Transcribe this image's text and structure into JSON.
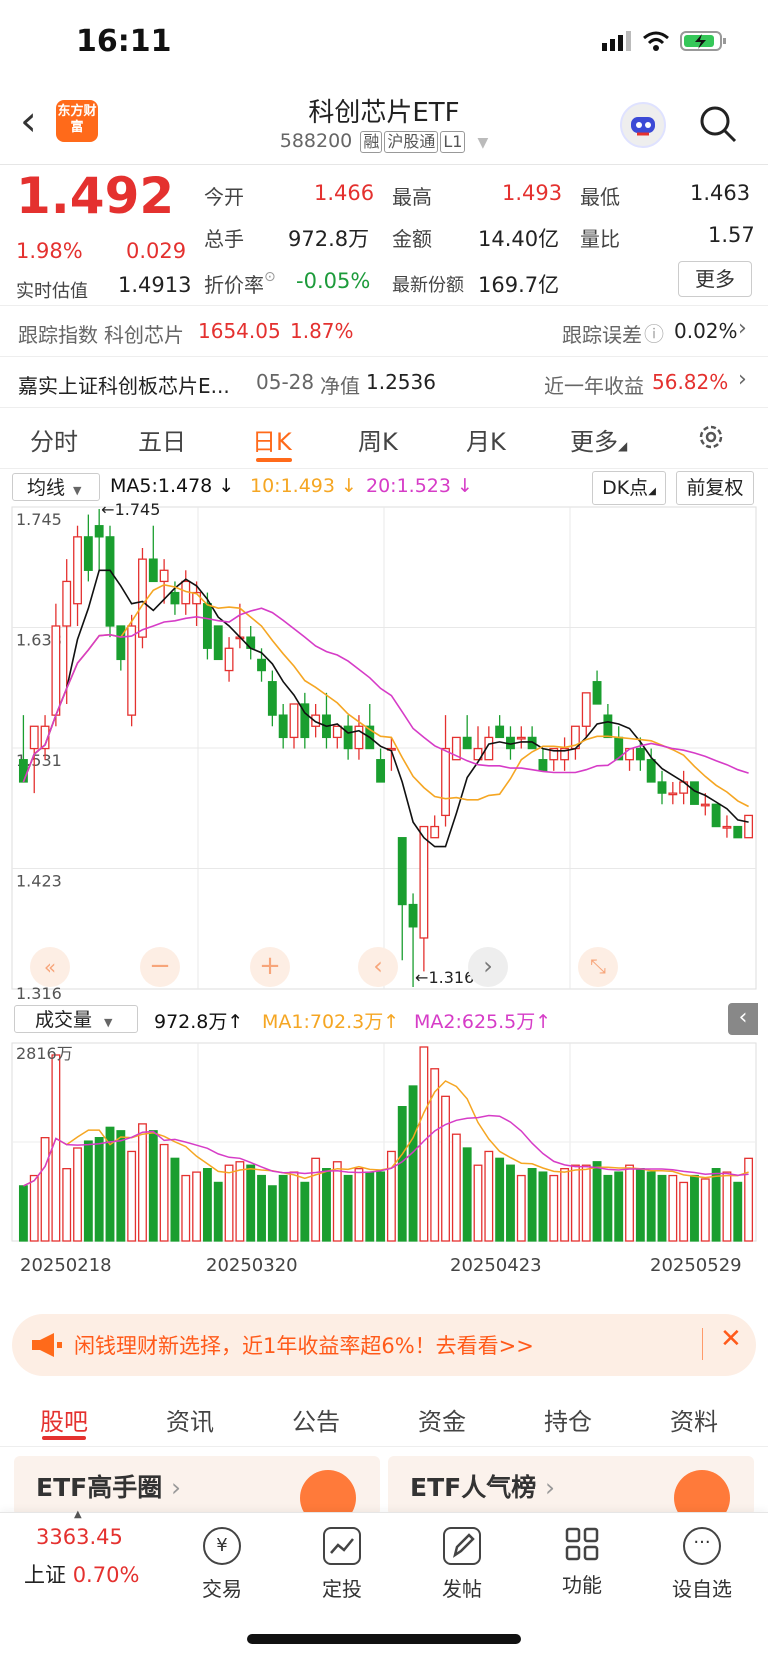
{
  "status": {
    "time": "16:11"
  },
  "header": {
    "back_icon": "chevron-left-icon",
    "logo_text": "东方财富",
    "title": "科创芯片ETF",
    "code": "588200",
    "tags": [
      "融",
      "沪股通",
      "L1"
    ]
  },
  "quote": {
    "price": "1.492",
    "change_pct": "1.98%",
    "change": "0.029",
    "est_label": "实时估值",
    "est_value": "1.4913",
    "open_label": "今开",
    "open": "1.466",
    "high_label": "最高",
    "high": "1.493",
    "low_label": "最低",
    "low": "1.463",
    "vol_label": "总手",
    "vol": "972.8万",
    "amt_label": "金额",
    "amt": "14.40亿",
    "ratio_label": "量比",
    "ratio": "1.57",
    "premium_label": "折价率",
    "premium": "-0.05%",
    "share_label": "最新份额",
    "share": "169.7亿",
    "more": "更多"
  },
  "tracking": {
    "label": "跟踪指数",
    "index": "科创芯片",
    "value": "1654.05",
    "pct": "1.87%",
    "err_label": "跟踪误差",
    "err": "0.02%"
  },
  "fund": {
    "name": "嘉实上证科创板芯片E...",
    "date": "05-28",
    "nav_label": "净值",
    "nav": "1.2536",
    "ret_label": "近一年收益",
    "ret": "56.82%"
  },
  "tabs": [
    "分时",
    "五日",
    "日K",
    "周K",
    "月K",
    "更多"
  ],
  "indicators": {
    "ma_select": "均线",
    "ma5": "MA5:1.478",
    "ma10": "10:1.493",
    "ma20": "20:1.523",
    "dk": "DK点",
    "adjust": "前复权"
  },
  "chart_labels": {
    "y_ticks": [
      "1.745",
      "1.638",
      "1.531",
      "1.423",
      "1.316"
    ],
    "high_mark": "1.745",
    "low_mark": "1.316",
    "vol_select": "成交量",
    "vol_value": "972.8万",
    "ma1": "MA1:702.3万",
    "ma2": "MA2:625.5万",
    "vol_max": "2816万",
    "dates": [
      "20250218",
      "20250320",
      "20250423",
      "20250529"
    ]
  },
  "colors": {
    "up": "#e4312f",
    "down": "#1a9e2f",
    "ma5": "#111111",
    "ma10": "#f5a623",
    "ma20": "#d63cc7",
    "accent": "#ff6a1a"
  },
  "chart_data": {
    "type": "candlestick",
    "ylim": [
      1.316,
      1.745
    ],
    "series": [
      {
        "name": "MA5",
        "value": 1.478
      },
      {
        "name": "10",
        "value": 1.493
      },
      {
        "name": "20",
        "value": 1.523
      }
    ],
    "candles": [
      [
        1.52,
        1.56,
        1.5,
        1.5
      ],
      [
        1.53,
        1.53,
        1.49,
        1.55
      ],
      [
        1.53,
        1.56,
        1.52,
        1.55
      ],
      [
        1.56,
        1.66,
        1.55,
        1.64
      ],
      [
        1.64,
        1.7,
        1.57,
        1.68
      ],
      [
        1.66,
        1.73,
        1.64,
        1.72
      ],
      [
        1.72,
        1.74,
        1.68,
        1.69
      ],
      [
        1.73,
        1.745,
        1.69,
        1.72
      ],
      [
        1.72,
        1.73,
        1.63,
        1.64
      ],
      [
        1.64,
        1.64,
        1.6,
        1.61
      ],
      [
        1.56,
        1.65,
        1.55,
        1.64
      ],
      [
        1.63,
        1.71,
        1.62,
        1.7
      ],
      [
        1.7,
        1.73,
        1.68,
        1.68
      ],
      [
        1.68,
        1.7,
        1.66,
        1.69
      ],
      [
        1.67,
        1.68,
        1.65,
        1.66
      ],
      [
        1.66,
        1.69,
        1.65,
        1.68
      ],
      [
        1.66,
        1.68,
        1.64,
        1.67
      ],
      [
        1.66,
        1.67,
        1.61,
        1.62
      ],
      [
        1.64,
        1.64,
        1.61,
        1.61
      ],
      [
        1.6,
        1.63,
        1.59,
        1.62
      ],
      [
        1.63,
        1.66,
        1.62,
        1.63
      ],
      [
        1.63,
        1.64,
        1.61,
        1.62
      ],
      [
        1.61,
        1.62,
        1.59,
        1.6
      ],
      [
        1.59,
        1.6,
        1.55,
        1.56
      ],
      [
        1.56,
        1.57,
        1.53,
        1.54
      ],
      [
        1.54,
        1.57,
        1.53,
        1.57
      ],
      [
        1.57,
        1.58,
        1.53,
        1.54
      ],
      [
        1.55,
        1.57,
        1.54,
        1.56
      ],
      [
        1.56,
        1.58,
        1.53,
        1.54
      ],
      [
        1.54,
        1.55,
        1.53,
        1.55
      ],
      [
        1.55,
        1.56,
        1.52,
        1.53
      ],
      [
        1.53,
        1.56,
        1.52,
        1.55
      ],
      [
        1.55,
        1.57,
        1.53,
        1.53
      ],
      [
        1.52,
        1.53,
        1.5,
        1.5
      ],
      [
        1.53,
        1.54,
        1.51,
        1.53
      ],
      [
        1.45,
        1.45,
        1.34,
        1.39
      ],
      [
        1.39,
        1.4,
        1.316,
        1.37
      ],
      [
        1.36,
        1.41,
        1.33,
        1.46
      ],
      [
        1.45,
        1.47,
        1.45,
        1.46
      ],
      [
        1.47,
        1.56,
        1.46,
        1.53
      ],
      [
        1.52,
        1.54,
        1.52,
        1.54
      ],
      [
        1.54,
        1.56,
        1.53,
        1.53
      ],
      [
        1.52,
        1.55,
        1.52,
        1.53
      ],
      [
        1.52,
        1.55,
        1.52,
        1.54
      ],
      [
        1.55,
        1.56,
        1.54,
        1.54
      ],
      [
        1.54,
        1.55,
        1.52,
        1.53
      ],
      [
        1.54,
        1.55,
        1.53,
        1.54
      ],
      [
        1.54,
        1.55,
        1.53,
        1.53
      ],
      [
        1.52,
        1.53,
        1.51,
        1.51
      ],
      [
        1.52,
        1.53,
        1.51,
        1.53
      ],
      [
        1.52,
        1.54,
        1.51,
        1.53
      ],
      [
        1.53,
        1.55,
        1.52,
        1.55
      ],
      [
        1.55,
        1.58,
        1.54,
        1.58
      ],
      [
        1.59,
        1.6,
        1.57,
        1.57
      ],
      [
        1.56,
        1.57,
        1.54,
        1.54
      ],
      [
        1.54,
        1.55,
        1.52,
        1.52
      ],
      [
        1.52,
        1.53,
        1.51,
        1.53
      ],
      [
        1.53,
        1.54,
        1.51,
        1.52
      ],
      [
        1.52,
        1.53,
        1.5,
        1.5
      ],
      [
        1.5,
        1.51,
        1.48,
        1.49
      ],
      [
        1.49,
        1.5,
        1.48,
        1.49
      ],
      [
        1.49,
        1.51,
        1.48,
        1.5
      ],
      [
        1.5,
        1.5,
        1.48,
        1.48
      ],
      [
        1.48,
        1.49,
        1.47,
        1.48
      ],
      [
        1.48,
        1.48,
        1.46,
        1.46
      ],
      [
        1.46,
        1.47,
        1.45,
        1.46
      ],
      [
        1.46,
        1.46,
        1.45,
        1.45
      ],
      [
        1.45,
        1.47,
        1.45,
        1.47
      ]
    ],
    "volume_ylim": [
      0,
      2816
    ],
    "volumes": [
      800,
      950,
      1500,
      2700,
      1050,
      1350,
      1450,
      1500,
      1650,
      1600,
      1300,
      1700,
      1600,
      1400,
      1200,
      950,
      1000,
      1050,
      850,
      1100,
      1150,
      1100,
      950,
      800,
      950,
      1000,
      850,
      1200,
      1050,
      1150,
      950,
      1050,
      1000,
      1000,
      1300,
      1950,
      2250,
      2816,
      2500,
      2100,
      1550,
      1350,
      1100,
      1300,
      1200,
      1100,
      950,
      1050,
      1000,
      950,
      1050,
      1100,
      1100,
      1150,
      950,
      1000,
      1100,
      1050,
      1000,
      950,
      950,
      850,
      950,
      900,
      1050,
      1000,
      850,
      1200
    ]
  },
  "ad": {
    "text": "闲钱理财新选择，近1年收益率超6%！去看看>>"
  },
  "bottom_tabs": [
    "股吧",
    "资讯",
    "公告",
    "资金",
    "持仓",
    "资料"
  ],
  "cards": [
    "ETF高手圈",
    "ETF人气榜"
  ],
  "nav": {
    "index_value": "3363.45",
    "index_name": "上证",
    "index_pct": "0.70%",
    "items": [
      "交易",
      "定投",
      "发帖",
      "功能",
      "设自选"
    ]
  }
}
